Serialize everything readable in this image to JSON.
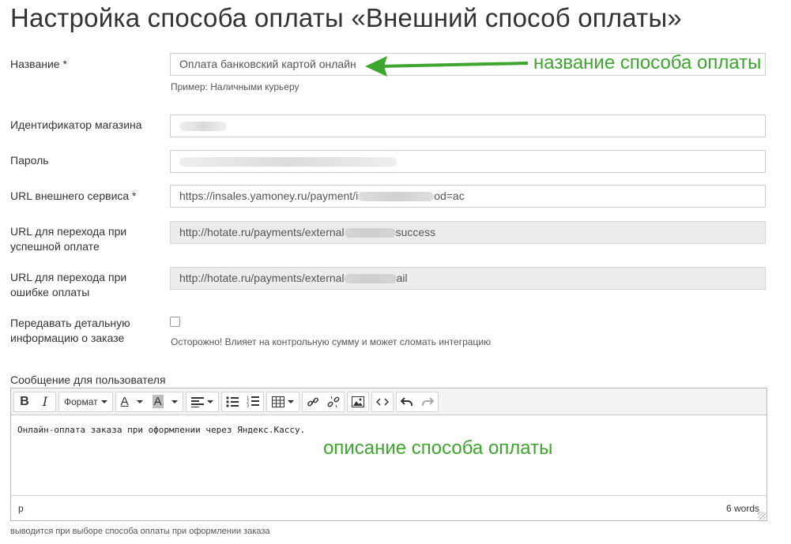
{
  "page_title": "Настройка способа оплаты «Внешний способ оплаты»",
  "fields": {
    "name": {
      "label": "Название *",
      "value": "Оплата банковский картой онлайн",
      "hint": "Пример: Наличными курьеру"
    },
    "shop_id": {
      "label": "Идентификатор магазина"
    },
    "password": {
      "label": "Пароль"
    },
    "service_url": {
      "label": "URL внешнего сервиса *",
      "value_start": "https://insales.yamoney.ru/payment/i",
      "value_end": "od=ac"
    },
    "success_url": {
      "label_line1": "URL для перехода при",
      "label_line2": "успешной оплате",
      "value_start": "http://hotate.ru/payments/external",
      "value_end": "success"
    },
    "fail_url": {
      "label_line1": "URL для перехода при",
      "label_line2": "ошибке оплаты",
      "value_start": "http://hotate.ru/payments/external",
      "value_end": "ail"
    },
    "detail_info": {
      "label_line1": "Передавать детальную",
      "label_line2": "информацию о заказе",
      "checked": false,
      "hint": "Осторожно! Влияет на контрольную сумму и может сломать интеграцию"
    }
  },
  "editor": {
    "label": "Сообщение для пользователя",
    "toolbar": {
      "bold": "B",
      "italic": "I",
      "format": "Формат",
      "font_color": "A",
      "bg_color": "A"
    },
    "content": "Онлайн-оплата заказа при оформлении через Яндекс.Кассу.",
    "path": "p",
    "word_count": "6 words",
    "hint": "выводится при выборе способа оплаты при оформлении заказа"
  },
  "annotations": {
    "name_note": "название способа оплаты",
    "description_note": "описание способа оплаты",
    "color": "#3ea52e"
  },
  "icons": [
    "bold-icon",
    "italic-icon",
    "font-color-icon",
    "background-color-icon",
    "align-icon",
    "bullet-list-icon",
    "numbered-list-icon",
    "table-icon",
    "link-icon",
    "unlink-icon",
    "image-icon",
    "code-icon",
    "undo-icon",
    "redo-icon"
  ]
}
